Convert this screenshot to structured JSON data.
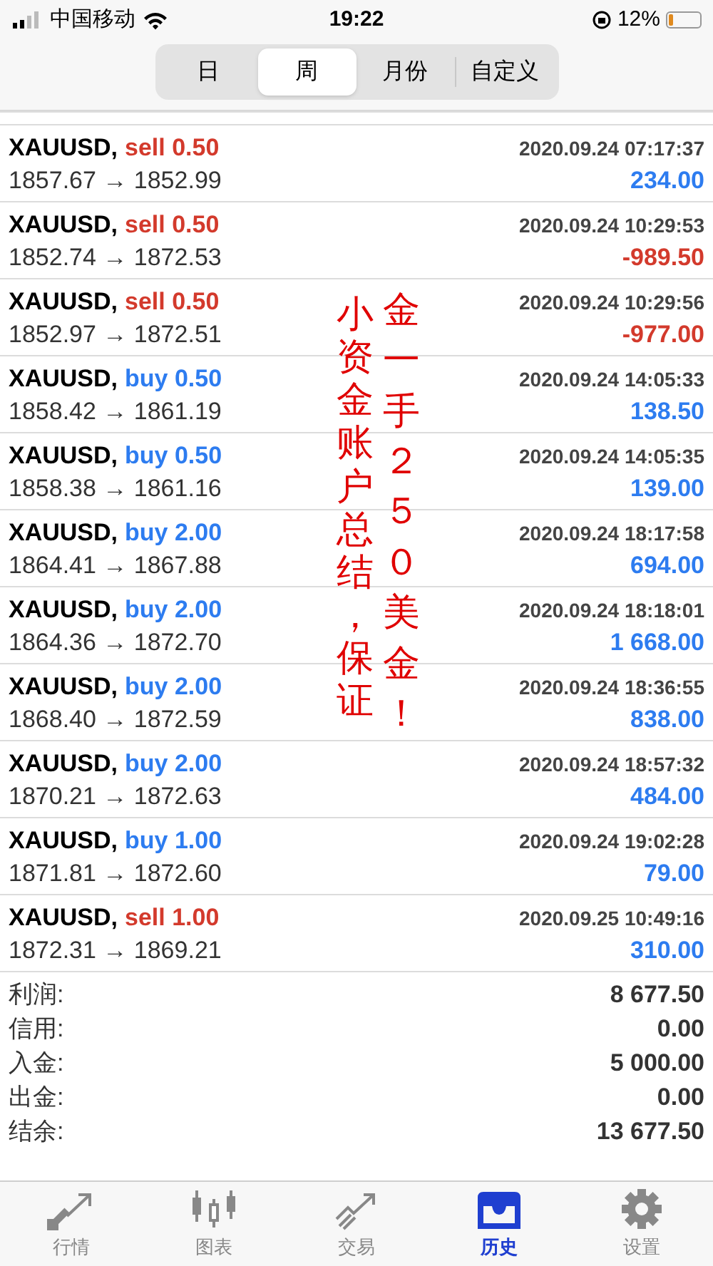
{
  "status_bar": {
    "carrier": "中国移动",
    "time": "19:22",
    "battery": "12%"
  },
  "period_tabs": [
    {
      "label": "日",
      "selected": false
    },
    {
      "label": "周",
      "selected": true
    },
    {
      "label": "月份",
      "selected": false
    },
    {
      "label": "自定义",
      "selected": false
    }
  ],
  "trades": [
    {
      "symbol": "XAUUSD,",
      "order": {
        "text": "sell 0.50",
        "color": "#d33a2c"
      },
      "prices": "1857.67 → 1852.99",
      "time": "2020.09.24 07:17:37",
      "profit": {
        "text": "234.00",
        "color": "#2d7cf0"
      }
    },
    {
      "symbol": "XAUUSD,",
      "order": {
        "text": "sell 0.50",
        "color": "#d33a2c"
      },
      "prices": "1852.74 → 1872.53",
      "time": "2020.09.24 10:29:53",
      "profit": {
        "text": "-989.50",
        "color": "#d33a2c"
      }
    },
    {
      "symbol": "XAUUSD,",
      "order": {
        "text": "sell 0.50",
        "color": "#d33a2c"
      },
      "prices": "1852.97 → 1872.51",
      "time": "2020.09.24 10:29:56",
      "profit": {
        "text": "-977.00",
        "color": "#d33a2c"
      }
    },
    {
      "symbol": "XAUUSD,",
      "order": {
        "text": "buy 0.50",
        "color": "#2d7cf0"
      },
      "prices": "1858.42 → 1861.19",
      "time": "2020.09.24 14:05:33",
      "profit": {
        "text": "138.50",
        "color": "#2d7cf0"
      }
    },
    {
      "symbol": "XAUUSD,",
      "order": {
        "text": "buy 0.50",
        "color": "#2d7cf0"
      },
      "prices": "1858.38 → 1861.16",
      "time": "2020.09.24 14:05:35",
      "profit": {
        "text": "139.00",
        "color": "#2d7cf0"
      }
    },
    {
      "symbol": "XAUUSD,",
      "order": {
        "text": "buy 2.00",
        "color": "#2d7cf0"
      },
      "prices": "1864.41 → 1867.88",
      "time": "2020.09.24 18:17:58",
      "profit": {
        "text": "694.00",
        "color": "#2d7cf0"
      }
    },
    {
      "symbol": "XAUUSD,",
      "order": {
        "text": "buy 2.00",
        "color": "#2d7cf0"
      },
      "prices": "1864.36 → 1872.70",
      "time": "2020.09.24 18:18:01",
      "profit": {
        "text": "1 668.00",
        "color": "#2d7cf0"
      }
    },
    {
      "symbol": "XAUUSD,",
      "order": {
        "text": "buy 2.00",
        "color": "#2d7cf0"
      },
      "prices": "1868.40 → 1872.59",
      "time": "2020.09.24 18:36:55",
      "profit": {
        "text": "838.00",
        "color": "#2d7cf0"
      }
    },
    {
      "symbol": "XAUUSD,",
      "order": {
        "text": "buy 2.00",
        "color": "#2d7cf0"
      },
      "prices": "1870.21 → 1872.63",
      "time": "2020.09.24 18:57:32",
      "profit": {
        "text": "484.00",
        "color": "#2d7cf0"
      }
    },
    {
      "symbol": "XAUUSD,",
      "order": {
        "text": "buy 1.00",
        "color": "#2d7cf0"
      },
      "prices": "1871.81 → 1872.60",
      "time": "2020.09.24 19:02:28",
      "profit": {
        "text": "79.00",
        "color": "#2d7cf0"
      }
    },
    {
      "symbol": "XAUUSD,",
      "order": {
        "text": "sell 1.00",
        "color": "#d33a2c"
      },
      "prices": "1872.31 → 1869.21",
      "time": "2020.09.25 10:49:16",
      "profit": {
        "text": "310.00",
        "color": "#2d7cf0"
      }
    }
  ],
  "summary": [
    {
      "label": "利润:",
      "value": "8 677.50"
    },
    {
      "label": "信用:",
      "value": "0.00"
    },
    {
      "label": "入金:",
      "value": "5 000.00"
    },
    {
      "label": "出金:",
      "value": "0.00"
    },
    {
      "label": "结余:",
      "value": "13 677.50"
    }
  ],
  "annotation": [
    "小资金账户总结，保证",
    "金一手２５０美金！"
  ],
  "bottom_tabs": [
    {
      "label": "行情",
      "kind": "quotes",
      "selected": false
    },
    {
      "label": "图表",
      "kind": "chart",
      "selected": false
    },
    {
      "label": "交易",
      "kind": "trade",
      "selected": false
    },
    {
      "label": "历史",
      "kind": "history",
      "selected": true
    },
    {
      "label": "设置",
      "kind": "settings",
      "selected": false
    }
  ]
}
